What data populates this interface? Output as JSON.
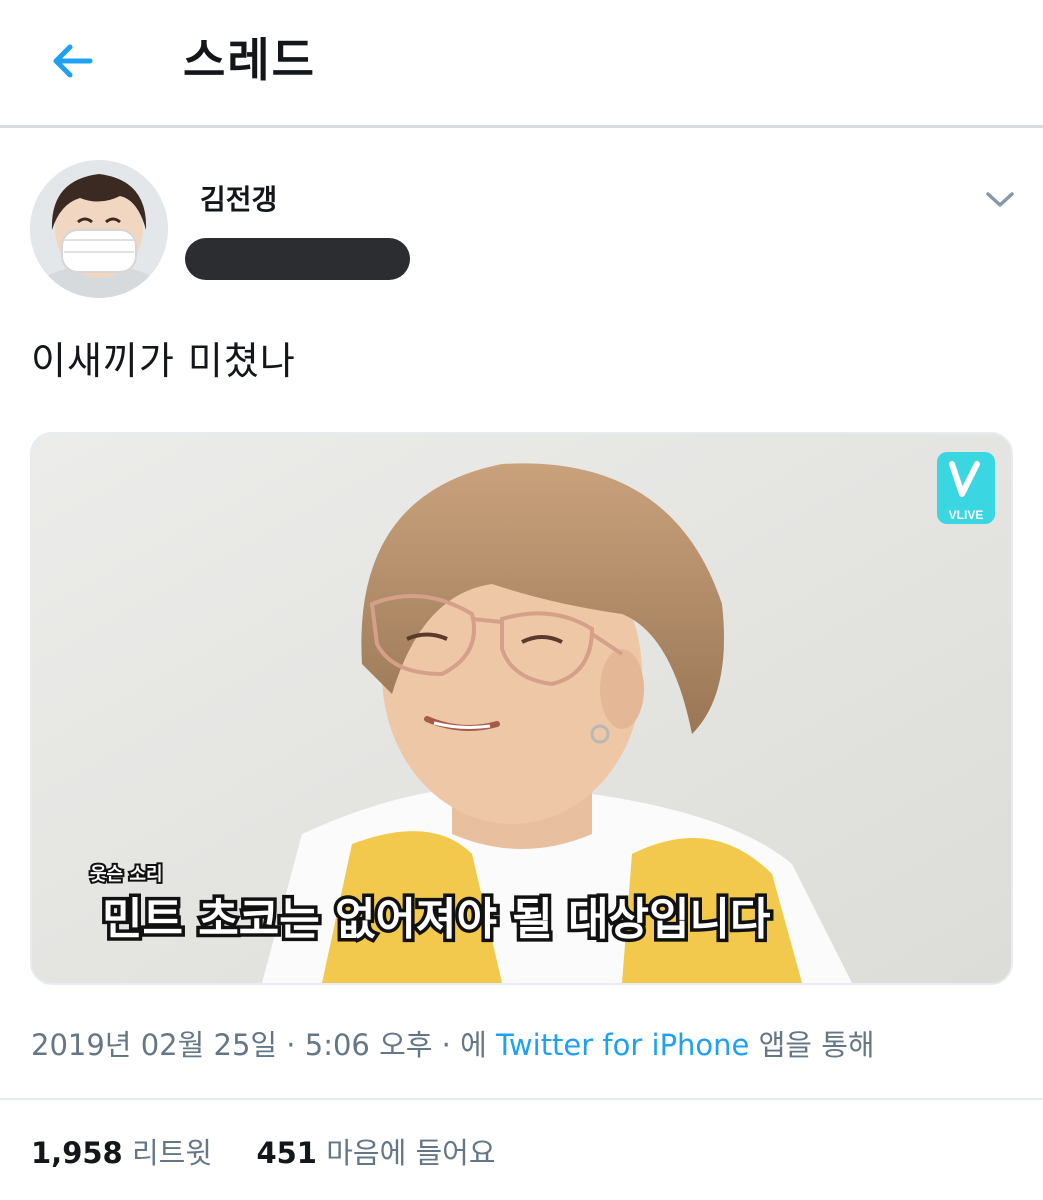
{
  "header": {
    "back_icon": "arrow-left-icon",
    "title": "스레드",
    "accent_color": "#1da1f2"
  },
  "tweet": {
    "author_name": "김전갱",
    "menu_icon": "chevron-down-icon",
    "text": "이새끼가 미쳤나",
    "media": {
      "caption_small": "웃슨 소리",
      "caption": "민트 초코는 없어져야 될 대상입니다",
      "logo_text": "VLIVE"
    },
    "timestamp": "2019년 02월 25일 · 5:06 오후 · 에",
    "source_link": "Twitter for iPhone",
    "source_suffix": "앱을 통해",
    "stats": {
      "retweets_count": "1,958",
      "retweets_label": "리트윗",
      "likes_count": "451",
      "likes_label": "마음에 들어요"
    }
  }
}
